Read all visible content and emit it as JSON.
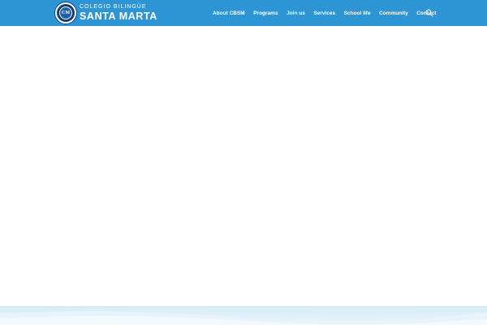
{
  "header": {
    "logo": {
      "line1": "COLEGIO BILINGÜE",
      "line2": "SANTA MARTA",
      "seal_text": "CM"
    },
    "nav": [
      {
        "label": "About CBSM"
      },
      {
        "label": "Programs"
      },
      {
        "label": "Join us"
      },
      {
        "label": "Services"
      },
      {
        "label": "School life"
      },
      {
        "label": "Community"
      },
      {
        "label": "Contact"
      }
    ],
    "search_icon": "search-icon"
  },
  "colors": {
    "header_bg": "#2e95d4",
    "logo_navy": "#0f3f7a",
    "footer_band": "#d9ecf8"
  }
}
